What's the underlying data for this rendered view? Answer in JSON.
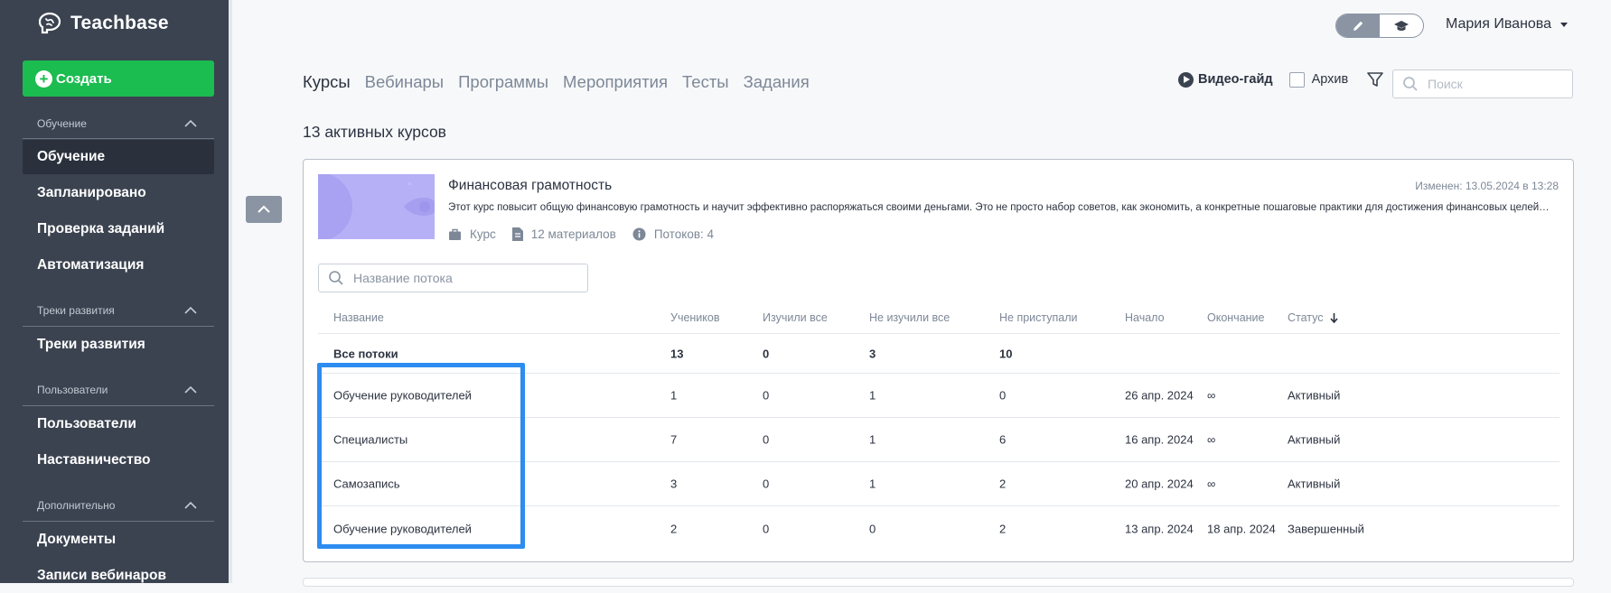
{
  "app": {
    "logo_text": "Teachbase"
  },
  "sidebar": {
    "create_label": "Создать",
    "sections": [
      {
        "title": "Обучение",
        "items": [
          "Обучение",
          "Запланировано",
          "Проверка заданий",
          "Автоматизация"
        ]
      },
      {
        "title": "Треки развития",
        "items": [
          "Треки развития"
        ]
      },
      {
        "title": "Пользователи",
        "items": [
          "Пользователи",
          "Наставничество"
        ]
      },
      {
        "title": "Дополнительно",
        "items": [
          "Документы",
          "Записи вебинаров"
        ]
      }
    ],
    "active_item": "Обучение"
  },
  "header": {
    "user_name": "Мария Иванова",
    "mode_active": "edit-mode"
  },
  "tabs": [
    "Курсы",
    "Вебинары",
    "Программы",
    "Мероприятия",
    "Тесты",
    "Задания"
  ],
  "active_tab": "Курсы",
  "toolbar": {
    "video_guide": "Видео-гайд",
    "archive": "Архив",
    "search_placeholder": "Поиск"
  },
  "courses_count": "13 активных курсов",
  "course": {
    "title": "Финансовая грамотность",
    "modified": "Изменен: 13.05.2024 в 13:28",
    "description": "Этот курс повысит общую финансовую грамотность и научит эффективно распоряжаться своими деньгами. Это не просто набор советов, как экономить, а конкретные пошаговые практики для достижения финансовых целей…",
    "type": "Курс",
    "materials": "12 материалов",
    "streams": "Потоков: 4",
    "stream_search_placeholder": "Название потока"
  },
  "table": {
    "columns": [
      "Название",
      "Учеников",
      "Изучили все",
      "Не изучили все",
      "Не приступали",
      "Начало",
      "Окончание",
      "Статус"
    ],
    "summary": [
      "Все потоки",
      "13",
      "0",
      "3",
      "10",
      "",
      "",
      ""
    ],
    "rows": [
      [
        "Обучение руководителей",
        "1",
        "0",
        "1",
        "0",
        "26 апр. 2024",
        "∞",
        "Активный"
      ],
      [
        "Специалисты",
        "7",
        "0",
        "1",
        "6",
        "16 апр. 2024",
        "∞",
        "Активный"
      ],
      [
        "Самозапись",
        "3",
        "0",
        "1",
        "2",
        "20 апр. 2024",
        "∞",
        "Активный"
      ],
      [
        "Обучение руководителей",
        "2",
        "0",
        "0",
        "2",
        "13 апр. 2024",
        "18 апр. 2024",
        "Завершенный"
      ]
    ]
  },
  "colors": {
    "sidebar": "#3b4350",
    "create": "#1bbc50",
    "highlight": "#2d8cf0",
    "thumb": "#b6b0f6"
  }
}
